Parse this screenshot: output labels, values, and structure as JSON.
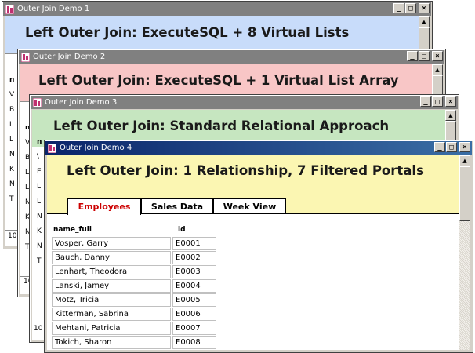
{
  "windows": [
    {
      "title": "Outer Join Demo 1",
      "heading": "Left Outer Join: ExecuteSQL + 8 Virtual Lists",
      "header_color": "#c8dcfa"
    },
    {
      "title": "Outer Join Demo 2",
      "heading": "Left Outer Join: ExecuteSQL + 1 Virtual List Array",
      "header_color": "#f8c6c6"
    },
    {
      "title": "Outer Join Demo 3",
      "heading": "Left Outer Join: Standard Relational Approach",
      "header_color": "#c6e6c0"
    },
    {
      "title": "Outer Join Demo 4",
      "heading": "Left Outer Join: 1 Relationship, 7 Filtered Portals",
      "header_color": "#fbf6b2"
    }
  ],
  "window_controls": {
    "minimize": "_",
    "maximize": "□",
    "close": "×"
  },
  "tabs": [
    {
      "label": "Employees",
      "active": true
    },
    {
      "label": "Sales Data",
      "active": false
    },
    {
      "label": "Week View",
      "active": false
    }
  ],
  "columns": {
    "name": "name_full",
    "id": "id"
  },
  "employees": [
    {
      "name": "Vosper, Garry",
      "id": "E0001"
    },
    {
      "name": "Bauch, Danny",
      "id": "E0002"
    },
    {
      "name": "Lenhart, Theodora",
      "id": "E0003"
    },
    {
      "name": "Lanski, Jamey",
      "id": "E0004"
    },
    {
      "name": "Motz, Tricia",
      "id": "E0005"
    },
    {
      "name": "Kitterman, Sabrina",
      "id": "E0006"
    },
    {
      "name": "Mehtani, Patricia",
      "id": "E0007"
    },
    {
      "name": "Tokich, Sharon",
      "id": "E0008"
    }
  ],
  "background_fragments": {
    "w1_letters": [
      "n",
      "V",
      "B",
      "L",
      "L",
      "N",
      "K",
      "N",
      "T"
    ],
    "w1_footer": "10",
    "w2_letters": [
      "n",
      "V",
      "B",
      "L",
      "L",
      "N",
      "K",
      "N",
      "T"
    ],
    "w2_footer": "10",
    "w3_letters": [
      "n",
      "\\",
      "E",
      "L",
      "L",
      "N",
      "K",
      "N",
      "T"
    ],
    "w3_footer": "10"
  },
  "colors": {
    "active_tab_text": "#cc0000",
    "active_titlebar": "#0a246a",
    "inactive_titlebar": "#808080"
  }
}
